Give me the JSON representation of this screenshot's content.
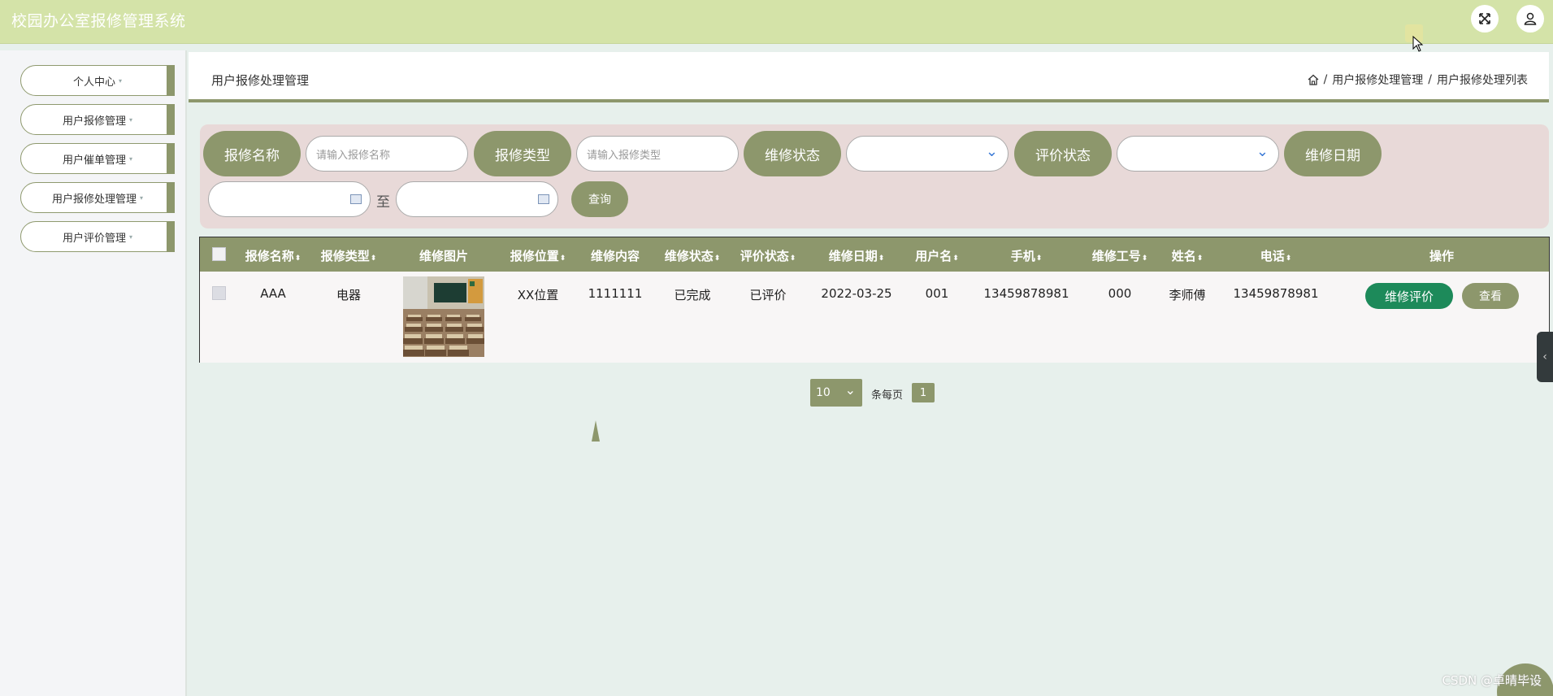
{
  "header": {
    "app_title": "校园办公室报修管理系统"
  },
  "sidebar": {
    "items": [
      {
        "label": "个人中心"
      },
      {
        "label": "用户报修管理"
      },
      {
        "label": "用户催单管理"
      },
      {
        "label": "用户报修处理管理"
      },
      {
        "label": "用户评价管理"
      }
    ],
    "caret": "▾"
  },
  "breadcrumb": {
    "page_title": "用户报修处理管理",
    "sep": "/",
    "path": [
      "用户报修处理管理",
      "用户报修处理列表"
    ]
  },
  "search": {
    "name_label": "报修名称",
    "name_placeholder": "请输入报修名称",
    "type_label": "报修类型",
    "type_placeholder": "请输入报修类型",
    "status_label": "维修状态",
    "status_value": "",
    "eval_label": "评价状态",
    "eval_value": "",
    "date_label": "维修日期",
    "to_label": "至",
    "query_button": "查询"
  },
  "table": {
    "columns": [
      "报修名称",
      "报修类型",
      "维修图片",
      "报修位置",
      "维修内容",
      "维修状态",
      "评价状态",
      "维修日期",
      "用户名",
      "手机",
      "维修工号",
      "姓名",
      "电话",
      "操作"
    ],
    "sort_icon": "⬍",
    "rows": [
      {
        "name": "AAA",
        "type": "电器",
        "image": "classroom-photo",
        "location": "XX位置",
        "content": "1111111",
        "status": "已完成",
        "eval_status": "已评价",
        "date": "2022-03-25",
        "username": "001",
        "phone": "13459878981",
        "worker_id": "000",
        "worker_name": "李师傅",
        "worker_phone": "13459878981",
        "actions": {
          "evaluate": "维修评价",
          "view": "查看"
        }
      }
    ]
  },
  "pagination": {
    "page_size": "10",
    "per_page_label": "条每页",
    "current_page": "1"
  },
  "watermark": "CSDN @卓晴毕设",
  "colors": {
    "primary": "#8d976c",
    "header_bg": "#d4e3a8",
    "search_bg": "#e8d9d8",
    "eval_button": "#1d8a5a"
  }
}
